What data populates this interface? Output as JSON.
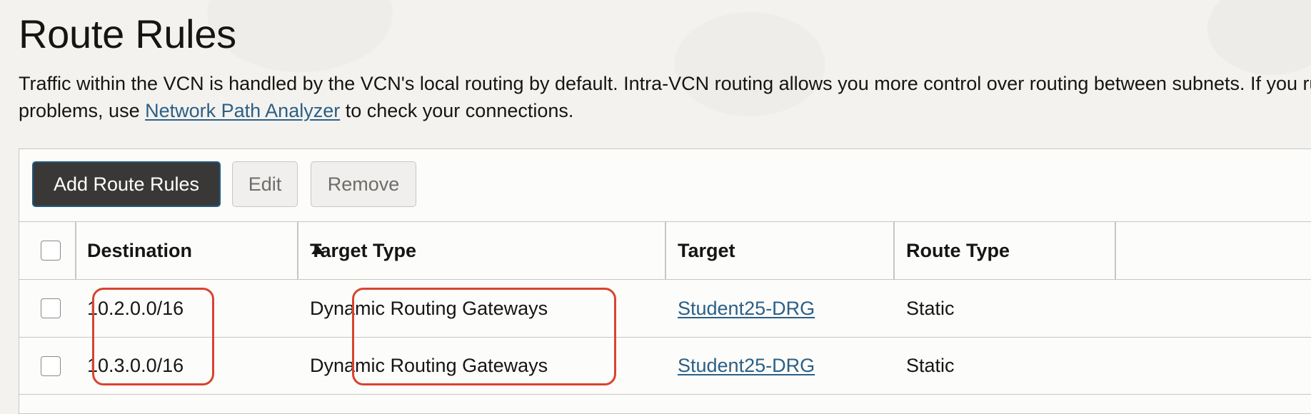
{
  "page": {
    "title": "Route Rules",
    "description_line1": "Traffic within the VCN is handled by the VCN's local routing by default. Intra-VCN routing allows you more control over routing between subnets. If you run into",
    "description_line2_before": "problems, use ",
    "description_link": "Network Path Analyzer",
    "description_line2_after": " to check your connections."
  },
  "toolbar": {
    "add_label": "Add Route Rules",
    "edit_label": "Edit",
    "remove_label": "Remove"
  },
  "table": {
    "columns": {
      "destination": "Destination",
      "target_type": "Target Type",
      "target": "Target",
      "route_type": "Route Type"
    },
    "sort": {
      "column": "Destination",
      "direction": "ascending",
      "icon": "sort-ascending-icon"
    },
    "rows": [
      {
        "destination": "10.2.0.0/16",
        "target_type": "Dynamic Routing Gateways",
        "target": "Student25-DRG",
        "route_type": "Static"
      },
      {
        "destination": "10.3.0.0/16",
        "target_type": "Dynamic Routing Gateways",
        "target": "Student25-DRG",
        "route_type": "Static"
      }
    ]
  },
  "colors": {
    "accent_link": "#2b5f85",
    "primary_button_bg": "#3a3836",
    "primary_button_border": "#1f5a7d",
    "highlight_annotation": "#d9432e"
  }
}
